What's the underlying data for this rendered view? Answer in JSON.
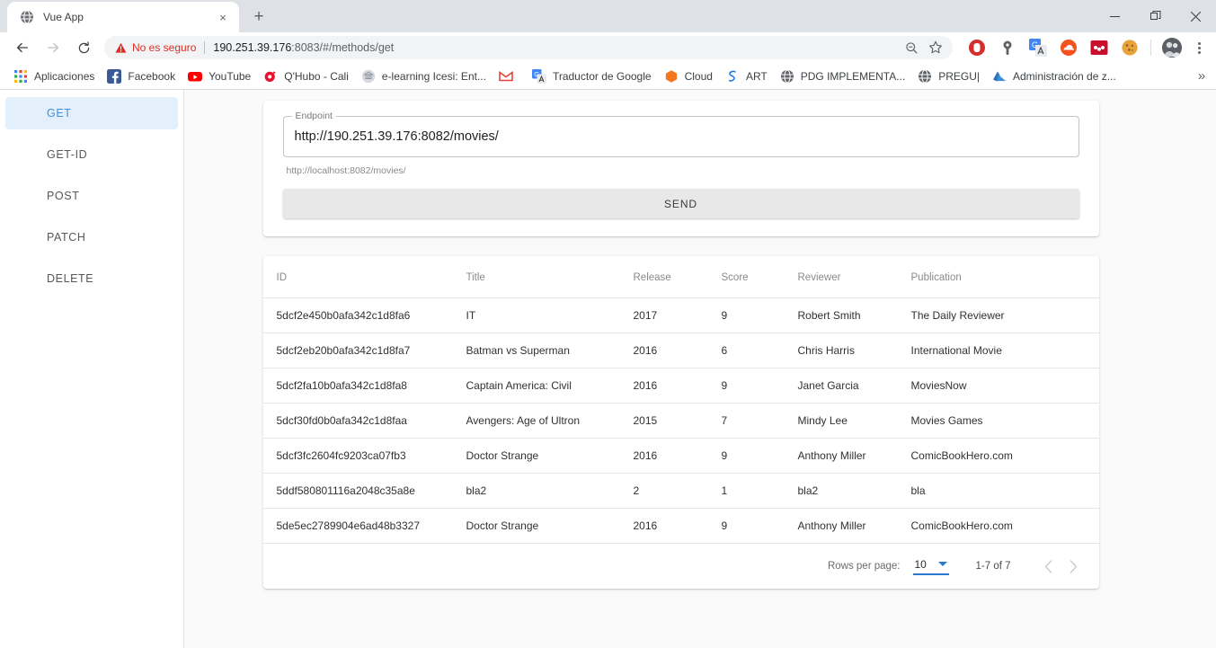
{
  "browser": {
    "tab": {
      "title": "Vue App",
      "favicon": "globe-icon",
      "close": "×"
    },
    "newtab_label": "+",
    "window_controls": {
      "minimize": "—",
      "maximize": "❐",
      "close": "✕"
    },
    "nav": {
      "back": "←",
      "forward": "→",
      "reload": "⟳"
    },
    "omnibox": {
      "security_text": "No es seguro",
      "url_host": "190.251.39.176",
      "url_rest": ":8083/#/methods/get",
      "zoom_icon": "zoom-out-icon",
      "bookmark_icon": "star-icon"
    },
    "extensions": [
      {
        "name": "adblock-extension-icon",
        "color": "#d32f2f"
      },
      {
        "name": "lastpass-extension-icon",
        "color": "#57606a"
      },
      {
        "name": "google-translate-extension-icon",
        "color": "#4285f4"
      },
      {
        "name": "cloud-extension-icon",
        "color": "#f4511e"
      },
      {
        "name": "mendeley-extension-icon",
        "color": "#c8102e"
      },
      {
        "name": "cookie-extension-icon",
        "color": "#e8a33d"
      }
    ],
    "profile_avatar": "user-avatar",
    "menu": "three-dots-menu-icon",
    "bookmarks": [
      {
        "label": "Aplicaciones",
        "icon": "apps-grid-icon"
      },
      {
        "label": "Facebook",
        "icon": "facebook-icon"
      },
      {
        "label": "YouTube",
        "icon": "youtube-icon"
      },
      {
        "label": "Q'Hubo - Cali",
        "icon": "qhubo-icon"
      },
      {
        "label": "e-learning Icesi: Ent...",
        "icon": "icesi-icon"
      },
      {
        "label": "",
        "icon": "gmail-icon"
      },
      {
        "label": "Traductor de Google",
        "icon": "google-translate-icon"
      },
      {
        "label": "Cloud",
        "icon": "cloud-icon"
      },
      {
        "label": "ART",
        "icon": "art-icon"
      },
      {
        "label": "PDG IMPLEMENTA...",
        "icon": "globe-icon"
      },
      {
        "label": "PREGU|",
        "icon": "globe-icon"
      },
      {
        "label": "Administración de z...",
        "icon": "azure-icon"
      }
    ],
    "bookmarks_overflow": "»"
  },
  "app": {
    "sidebar": {
      "items": [
        {
          "label": "GET",
          "active": true
        },
        {
          "label": "GET-ID",
          "active": false
        },
        {
          "label": "POST",
          "active": false
        },
        {
          "label": "PATCH",
          "active": false
        },
        {
          "label": "DELETE",
          "active": false
        }
      ]
    },
    "endpoint": {
      "legend": "Endpoint",
      "value": "http://190.251.39.176:8082/movies/",
      "placeholder": "http://localhost:8082/movies/",
      "hint": "http://localhost:8082/movies/",
      "send_label": "SEND"
    },
    "table": {
      "columns": [
        "ID",
        "Title",
        "Release",
        "Score",
        "Reviewer",
        "Publication"
      ],
      "rows": [
        {
          "id": "5dcf2e450b0afa342c1d8fa6",
          "title": "IT",
          "release": "2017",
          "score": "9",
          "reviewer": "Robert Smith",
          "publication": "The Daily Reviewer"
        },
        {
          "id": "5dcf2eb20b0afa342c1d8fa7",
          "title": "Batman vs Superman",
          "release": "2016",
          "score": "6",
          "reviewer": "Chris Harris",
          "publication": "International Movie"
        },
        {
          "id": "5dcf2fa10b0afa342c1d8fa8",
          "title": "Captain America: Civil",
          "release": "2016",
          "score": "9",
          "reviewer": "Janet Garcia",
          "publication": "MoviesNow"
        },
        {
          "id": "5dcf30fd0b0afa342c1d8faa",
          "title": "Avengers: Age of Ultron",
          "release": "2015",
          "score": "7",
          "reviewer": "Mindy Lee",
          "publication": "Movies Games"
        },
        {
          "id": "5dcf3fc2604fc9203ca07fb3",
          "title": "Doctor Strange",
          "release": "2016",
          "score": "9",
          "reviewer": "Anthony Miller",
          "publication": "ComicBookHero.com"
        },
        {
          "id": "5ddf580801116a2048c35a8e",
          "title": "bla2",
          "release": "2",
          "score": "1",
          "reviewer": "bla2",
          "publication": "bla"
        },
        {
          "id": "5de5ec2789904e6ad48b3327",
          "title": "Doctor Strange",
          "release": "2016",
          "score": "9",
          "reviewer": "Anthony Miller",
          "publication": "ComicBookHero.com"
        }
      ],
      "pagination": {
        "rows_per_page_label": "Rows per page:",
        "rows_per_page_value": "10",
        "range_label": "1-7 of 7",
        "prev": "‹",
        "next": "›"
      }
    },
    "colors": {
      "accent": "#2979ce",
      "active_item_bg": "#e3effb",
      "page_bg": "#fafafa"
    }
  }
}
